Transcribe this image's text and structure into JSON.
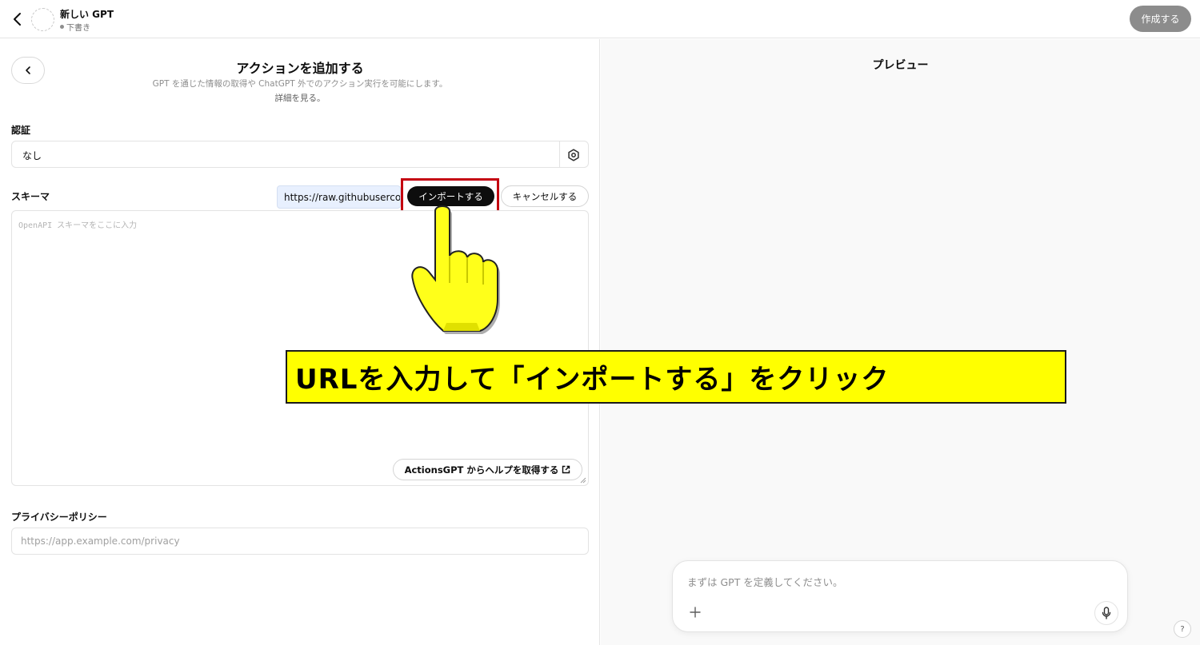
{
  "header": {
    "gpt_name": "新しい GPT",
    "gpt_status": "下書き",
    "create_label": "作成する"
  },
  "editor": {
    "title": "アクションを追加する",
    "description": "GPT を通じた情報の取得や ChatGPT 外でのアクション実行を可能にします。",
    "learn_more": "詳細を見る。",
    "auth": {
      "label": "認証",
      "value": "なし"
    },
    "schema": {
      "label": "スキーマ",
      "url_value": "https://raw.githubuserco",
      "import_label": "インポートする",
      "cancel_label": "キャンセルする",
      "placeholder": "OpenAPI スキーマをここに入力",
      "help_label": "ActionsGPT からヘルプを取得する"
    },
    "privacy": {
      "label": "プライバシーポリシー",
      "placeholder": "https://app.example.com/privacy"
    }
  },
  "preview": {
    "title": "プレビュー",
    "composer_placeholder": "まずは GPT を定義してください。",
    "help_label": "?"
  },
  "annotation": {
    "callout_text": "URLを入力して「インポートする」をクリック",
    "highlight_color": "#c40010",
    "callout_color": "#ffff00"
  }
}
